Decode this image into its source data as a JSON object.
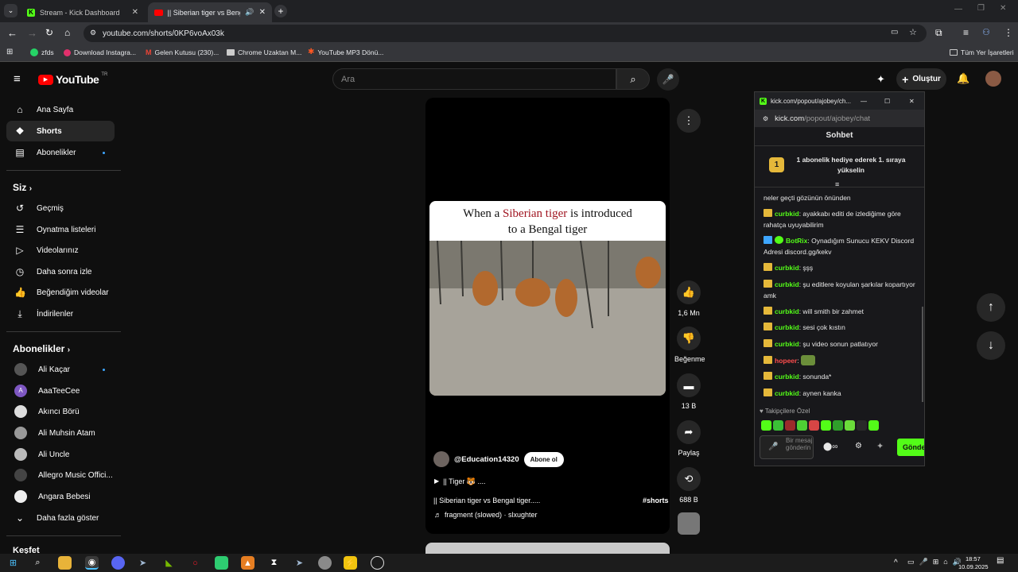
{
  "browser": {
    "tabs": [
      {
        "label": "Stream - Kick Dashboard"
      },
      {
        "label": "|| Siberian tiger vs Bengal ti"
      }
    ],
    "url": "youtube.com/shorts/0KP6voAx03k",
    "bookmarks": [
      "zfds",
      "Download Instagra...",
      "Gelen Kutusu (230)...",
      "Chrome Uzaktan M...",
      "YouTube MP3 Dönü..."
    ],
    "all_bookmarks": "Tüm Yer İşaretleri"
  },
  "youtube": {
    "logo": "YouTube",
    "logo_suffix": "TR",
    "search_placeholder": "Ara",
    "create_label": "Oluştur",
    "sidebar": {
      "main": [
        "Ana Sayfa",
        "Shorts",
        "Abonelikler"
      ],
      "you_title": "Siz",
      "you_items": [
        "Geçmiş",
        "Oynatma listeleri",
        "Videolarınız",
        "Daha sonra izle",
        "Beğendiğim videolar",
        "İndirilenler"
      ],
      "subs_title": "Abonelikler",
      "subs": [
        "Ali Kaçar",
        "AaaTeeCee",
        "Akıncı Börü",
        "Ali Muhsin Atam",
        "Ali Uncle",
        "Allegro Music Offici...",
        "Angara Bebesi"
      ],
      "more": "Daha fazla göster",
      "explore": "Keşfet"
    },
    "short": {
      "caption_line1_pre": "When a ",
      "caption_highlight": "Siberian tiger",
      "caption_line1_post": " is introduced",
      "caption_line2": "to a Bengal tiger",
      "channel": "@Education14320",
      "subscribe": "Abone ol",
      "playlist": "|| Tiger 🐯 ....",
      "title": "|| Siberian tiger vs Bengal tiger.....",
      "hashtag": "#shorts",
      "music": "fragment (slowed) · slxughter",
      "likes": "1,6 Mn",
      "dislike": "Beğenme",
      "comments": "13 B",
      "share": "Paylaş",
      "remix": "688 B"
    }
  },
  "kick": {
    "window_title": "kick.com/popout/ajobey/ch...",
    "url_host": "kick.com",
    "url_path": "/popout/ajobey/chat",
    "header": "Sohbet",
    "pinned_rank": "1",
    "pinned_text": "1 abonelik hediye ederek 1. sıraya yükselin",
    "partial_msg": "neler geçti gözünün önünden",
    "messages": [
      {
        "user": "curbkid",
        "text": ": ayakkabı editi de izlediğime göre rahatça uyuyabilirim"
      },
      {
        "user": "BotRix",
        "text": ": Oynadığım Sunucu KEKV Discord Adresi discord.gg/kekv"
      },
      {
        "user": "curbkid",
        "text": ": şşş"
      },
      {
        "user": "curbkid",
        "text": ": şu editlere koyulan şarkılar kopartıyor amk"
      },
      {
        "user": "curbkid",
        "text": ": will smith bir zahmet"
      },
      {
        "user": "curbkid",
        "text": ": sesi çok kıstın"
      },
      {
        "user": "curbkid",
        "text": ": şu video sonun patlatıyor"
      },
      {
        "user": "hopeer",
        "text": ":"
      },
      {
        "user": "curbkid",
        "text": ": sonunda*"
      },
      {
        "user": "curbkid",
        "text": ": aynen kanka"
      }
    ],
    "followers_label": "Takipçilere Özel",
    "input_placeholder": "Bir mesaj gönderin",
    "send_label": "Gönder"
  },
  "taskbar": {
    "time": "18:57",
    "date": "10.09.2025"
  },
  "colors": {
    "kick_green": "#53fc18",
    "youtube_red": "#ff0000",
    "link_blue": "#3ea6ff"
  }
}
